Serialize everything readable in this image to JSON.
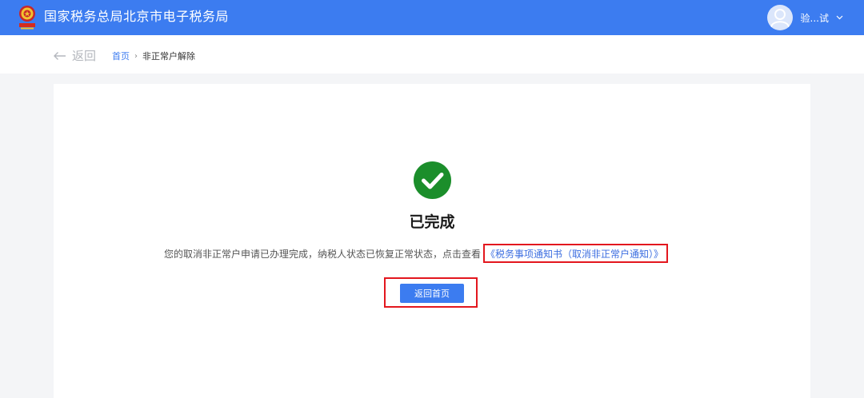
{
  "header": {
    "site_title": "国家税务总局北京市电子税务局",
    "user_name": "验...试"
  },
  "nav": {
    "back_label": "返回",
    "breadcrumb_home": "首页",
    "breadcrumb_sep": "›",
    "breadcrumb_current": "非正常户解除"
  },
  "result": {
    "status_title": "已完成",
    "message": "您的取消非正常户申请已办理完成，纳税人状态已恢复正常状态，点击查看",
    "notice_link": "《税务事项通知书（取消非正常户通知）》",
    "home_button": "返回首页"
  },
  "colors": {
    "header_blue": "#3c7cf0",
    "success_green": "#1b8e2b",
    "highlight_red": "#e3171e",
    "link_blue": "#3c6ee0"
  },
  "icons": {
    "logo": "tax-emblem-icon",
    "avatar": "user-avatar-icon",
    "dropdown": "chevron-down-icon",
    "back": "arrow-left-icon",
    "success": "check-circle-icon"
  }
}
